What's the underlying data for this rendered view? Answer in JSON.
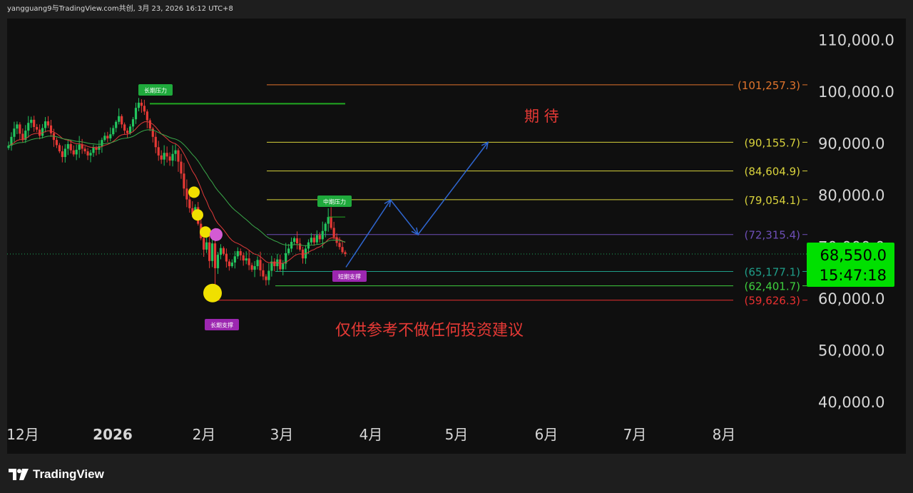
{
  "header": {
    "caption": "yangguang9与TradingView.com共创, 3月 23, 2026 16:12 UTC+8"
  },
  "footer": {
    "brand": "TradingView"
  },
  "chart_data": {
    "type": "candlestick",
    "x_labels": [
      "12月",
      "2026",
      "2月",
      "3月",
      "4月",
      "5月",
      "6月",
      "7月",
      "8月"
    ],
    "y_ticks": [
      110000,
      100000,
      90000,
      80000,
      70000,
      60000,
      50000,
      40000
    ],
    "y_tick_labels": [
      "110,000.0",
      "100,000.0",
      "90,000.0",
      "80,000.0",
      "70,000.0",
      "60,000.0",
      "50,000.0",
      "40,000.0"
    ],
    "ylim": [
      35000,
      112500
    ],
    "current_price": {
      "value": 68550,
      "label": "68,550.0",
      "countdown": "15:47:18",
      "color": "#00e000"
    },
    "levels": [
      {
        "value": 101257.3,
        "label": "(101,257.3)",
        "color": "#e0742c"
      },
      {
        "value": 90155.7,
        "label": "(90,155.7)",
        "color": "#d8d23c"
      },
      {
        "value": 84604.9,
        "label": "(84,604.9)",
        "color": "#d8d23c"
      },
      {
        "value": 79054.1,
        "label": "(79,054.1)",
        "color": "#d8d23c"
      },
      {
        "value": 72315.4,
        "label": "(72,315.4)",
        "color": "#6e4fb8"
      },
      {
        "value": 65177.1,
        "label": "(65,177.1)",
        "color": "#1f9e8a"
      },
      {
        "value": 62401.7,
        "label": "(62,401.7)",
        "color": "#3ecf3e"
      },
      {
        "value": 59626.3,
        "label": "(59,626.3)",
        "color": "#e83030"
      }
    ],
    "labels": {
      "long_resistance": "长期压力",
      "mid_resistance": "中期压力",
      "long_support": "长期支撑",
      "short_support": "短期支撑",
      "expectation": "期  待",
      "disclaimer": "仅供参考不做任何投资建议"
    },
    "candles": {
      "description_free": true,
      "close": [
        89500,
        91200,
        92800,
        93600,
        91800,
        90600,
        92400,
        93900,
        94500,
        93100,
        92600,
        91400,
        92900,
        94200,
        93400,
        91900,
        90600,
        89600,
        88400,
        87300,
        88900,
        89800,
        88600,
        87800,
        88700,
        89700,
        88900,
        88400,
        87600,
        88100,
        89100,
        88700,
        89400,
        90600,
        91400,
        90900,
        91700,
        92900,
        94100,
        95200,
        93600,
        92400,
        91900,
        93200,
        94600,
        96800,
        97800,
        97200,
        96100,
        94400,
        92800,
        91200,
        89200,
        87600,
        86800,
        88100,
        87400,
        86600,
        87900,
        88600,
        86400,
        84100,
        81200,
        79100,
        77400,
        76200,
        77600,
        74400,
        71600,
        69400,
        70800,
        67200,
        70600,
        65800,
        68400,
        69700,
        68600,
        67100,
        66200,
        66900,
        68100,
        69100,
        68300,
        67300,
        67700,
        66400,
        65500,
        66200,
        67400,
        65400,
        64200,
        63500,
        65300,
        67100,
        66200,
        67500,
        65600,
        66700,
        68700,
        69600,
        70900,
        71600,
        70600,
        69400,
        67700,
        69600,
        70800,
        71700,
        70800,
        72200,
        71400,
        73000,
        74400,
        75700,
        73600,
        71800,
        70700,
        69900,
        68900,
        68550
      ],
      "ma_fast_color": "#e03a3a",
      "ma_slow_color": "#3aa84a"
    },
    "projection": [
      {
        "month_index": 3.72,
        "value": 66000
      },
      {
        "month_index": 4.23,
        "value": 79000
      },
      {
        "month_index": 4.55,
        "value": 72315
      },
      {
        "month_index": 5.35,
        "value": 90155
      }
    ]
  }
}
